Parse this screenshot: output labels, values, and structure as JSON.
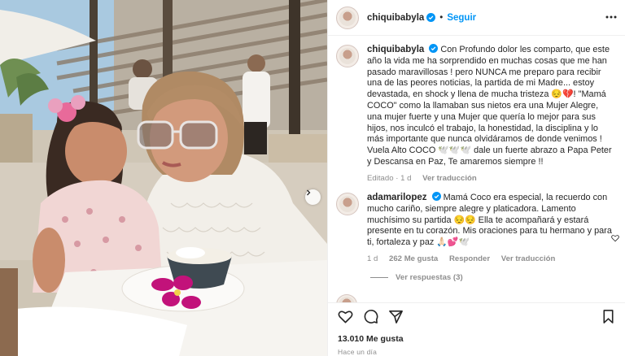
{
  "post": {
    "author": "chiquibabyla",
    "follow_label": "Seguir",
    "separator": "•",
    "more_options": "more-icon",
    "caption": "Con Profundo dolor les comparto, que este año la vida me ha sorprendido en muchas cosas que me han pasado maravillosas ! pero NUNCA me preparo para recibir una de las peores noticias, la partida de mi Madre... estoy devastada, en shock y llena de mucha tristeza 😔💔! \"Mamá COCO\" como la llamaban sus nietos era una Mujer Alegre, una mujer fuerte y una Mujer que quería lo mejor para sus hijos, nos inculcó el trabajo, la honestidad, la disciplina y lo más importante que nunca olvidáramos de donde venimos ! Vuela Alto COCO 🕊️🕊️🕊️ dale un fuerte abrazo a Papa Peter y Descansa en Paz, Te amaremos siempre !!",
    "caption_meta": {
      "edited": "Editado · 1 d",
      "translate": "Ver traducción"
    }
  },
  "comment": {
    "author": "adamarilopez",
    "text": "Mamá Coco era especial, la recuerdo con mucho cariño, siempre alegre y platicadora. Lamento muchísimo su partida 😔😔 Ella te acompañará y estará presente en tu corazón. Mis oraciones para tu hermano y para ti, fortaleza y paz 🙏🏻💕🕊️",
    "time": "1 d",
    "likes": "262 Me gusta",
    "reply": "Responder",
    "translate": "Ver traducción",
    "view_replies": "Ver respuestas (3)"
  },
  "actions": {
    "likes_count": "13.010 Me gusta",
    "time_ago": "Hace un día"
  },
  "colors": {
    "link": "#0095f6",
    "verified": "#0095f6",
    "muted": "#8e8e8e"
  }
}
